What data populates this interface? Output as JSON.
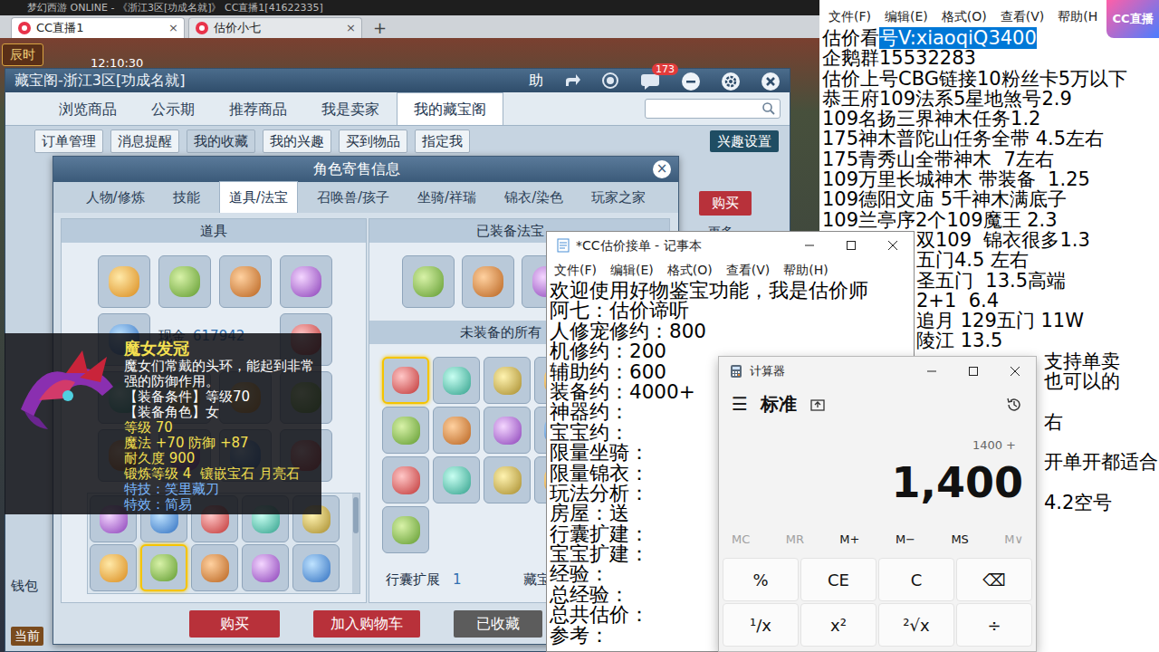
{
  "browser": {
    "caption": "梦幻西游 ONLINE - 《浙江3区[功成名就]》   CC直播1[41622335]",
    "tabs": [
      {
        "label": "CC直播1",
        "close": "×",
        "selected": true
      },
      {
        "label": "估价小七",
        "close": "×",
        "selected": false
      }
    ],
    "new_tab": "+"
  },
  "game": {
    "period": "辰时",
    "clock": "12:10:30"
  },
  "cc_logo": "CC直播",
  "right_notepad": {
    "menu": [
      "文件(F)",
      "编辑(E)",
      "格式(O)",
      "查看(V)",
      "帮助(H"
    ],
    "heading": [
      {
        "text": "估价看",
        "selected": false
      },
      {
        "text": "号V:xiaoqiQ3400",
        "selected": true
      }
    ],
    "lines": [
      "企鹅群15532283",
      "估价上号CBG链接10粉丝卡5万以下",
      "恭王府109法系5星地煞号2.9",
      "109名扬三界神木任务1.2",
      "175神木普陀山任务全带 4.5左右",
      "175青秀山全带神木  7左右",
      "109万里长城神木 带装备  1.25",
      "109德阳文庙 5千神木满底子",
      "109兰亭序2个109魔王 2.3"
    ],
    "mid_lines": [
      "双109  锦衣很多1.3",
      "五门4.5 左右",
      "圣五门  13.5高端",
      "2+1  6.4",
      "追月 129五门 11W",
      "陵江 13.5"
    ],
    "low_lines": [
      "支持单卖",
      "也可以的",
      "右",
      "开单开都适合",
      "4.2空号"
    ]
  },
  "cbg": {
    "title": "藏宝阁-浙江3区[功成名就]",
    "help": "助",
    "badge": "173",
    "nav": [
      {
        "label": "浏览商品",
        "selected": false
      },
      {
        "label": "公示期",
        "selected": false
      },
      {
        "label": "推荐商品",
        "selected": false
      },
      {
        "label": "我是卖家",
        "selected": false
      },
      {
        "label": "我的藏宝阁",
        "selected": true
      }
    ],
    "subnav": [
      {
        "label": "订单管理",
        "selected": false
      },
      {
        "label": "消息提醒",
        "selected": false
      },
      {
        "label": "我的收藏",
        "selected": true
      },
      {
        "label": "我的兴趣",
        "selected": false
      },
      {
        "label": "买到物品",
        "selected": false
      },
      {
        "label": "指定我",
        "selected": false
      }
    ],
    "interest_settings": "兴趣设置",
    "buy": "购买",
    "more": "更多",
    "wallet": "钱包",
    "current": "当前"
  },
  "dialog": {
    "title": "角色寄售信息",
    "close": "×",
    "tabs": [
      {
        "label": "人物/修炼",
        "selected": false
      },
      {
        "label": "技能",
        "selected": false
      },
      {
        "label": "道具/法宝",
        "selected": true
      },
      {
        "label": "召唤兽/孩子",
        "selected": false
      },
      {
        "label": "坐骑/祥瑞",
        "selected": false
      },
      {
        "label": "锦衣/染色",
        "selected": false
      },
      {
        "label": "玩家之家",
        "selected": false
      }
    ],
    "items_header": "道具",
    "cash_label": "现金",
    "cash_value": "617942",
    "items": [
      {
        "selected": false
      },
      {
        "selected": false
      },
      {
        "selected": false
      },
      {
        "selected": false
      },
      {
        "selected": false
      },
      {
        "selected": false
      },
      {
        "selected": false
      },
      {
        "selected": false
      },
      {
        "selected": false
      },
      {
        "selected": false
      },
      {
        "selected": false
      },
      {
        "selected": false
      },
      {
        "selected": false
      },
      {
        "selected": false
      }
    ],
    "lower_items": [
      {
        "selected": false
      },
      {
        "selected": false
      },
      {
        "selected": false
      },
      {
        "selected": false
      },
      {
        "selected": false
      },
      {
        "selected": false
      },
      {
        "selected": true
      },
      {
        "selected": false
      },
      {
        "selected": false
      },
      {
        "selected": false
      }
    ],
    "equipped_header": "已装备法宝",
    "equipped": [
      {
        "selected": false
      },
      {
        "selected": false
      },
      {
        "selected": false
      }
    ],
    "unequipped_header": "未装备的所有",
    "unequipped": [
      {
        "selected": true
      },
      {
        "selected": false
      },
      {
        "selected": false
      },
      {
        "selected": false
      },
      {
        "selected": false
      },
      {
        "selected": false
      },
      {
        "selected": false
      },
      {
        "selected": false
      },
      {
        "selected": false
      },
      {
        "selected": false
      },
      {
        "selected": false
      },
      {
        "selected": false
      },
      {
        "selected": false
      }
    ],
    "bag_label": "行囊扩展",
    "bag_value": "1",
    "vault_label": "藏宝",
    "buttons": [
      {
        "label": "购买",
        "kind": "primary"
      },
      {
        "label": "加入购物车",
        "kind": "primary"
      },
      {
        "label": "已收藏",
        "kind": "muted"
      }
    ]
  },
  "tooltip": {
    "name": "魔女发冠",
    "lines": [
      {
        "text": "魔女们常戴的头环，能起到非常强的防御作用。",
        "kind": "desc"
      },
      {
        "text": "【装备条件】等级70",
        "kind": "normal"
      },
      {
        "text": "【装备角色】女",
        "kind": "normal"
      },
      {
        "text": "等级 70",
        "kind": "attr"
      },
      {
        "text": "魔法 +70 防御 +87",
        "kind": "attr"
      },
      {
        "text": "耐久度 900",
        "kind": "attr"
      },
      {
        "text": "锻炼等级 4  镶嵌宝石 月亮石",
        "kind": "attr"
      },
      {
        "text": "特技：笑里藏刀",
        "kind": "special"
      },
      {
        "text": "特效：简易",
        "kind": "special"
      }
    ]
  },
  "cc_notepad": {
    "title": "*CC估价接单 - 记事本",
    "menu": [
      "文件(F)",
      "编辑(E)",
      "格式(O)",
      "查看(V)",
      "帮助(H)"
    ],
    "lines": [
      "欢迎使用好物鉴宝功能，我是估价师",
      "阿七：估价谛听",
      "人修宠修约：800",
      "机修约：200",
      "辅助约：600",
      "装备约：4000+",
      "神器约：",
      "宝宝约：",
      "限量坐骑：",
      "限量锦衣：",
      "玩法分析：",
      "房屋：送",
      "行囊扩建：",
      "宝宝扩建：",
      "经验：",
      "总经验：",
      "总共估价：",
      "参考："
    ]
  },
  "calculator": {
    "title": "计算器",
    "menu_icon": "☰",
    "mode": "标准",
    "history": "1400 +",
    "display": "1,400",
    "memory": [
      {
        "label": "MC",
        "disabled": true
      },
      {
        "label": "MR",
        "disabled": true
      },
      {
        "label": "M+",
        "disabled": false
      },
      {
        "label": "M−",
        "disabled": false
      },
      {
        "label": "MS",
        "disabled": false
      },
      {
        "label": "M∨",
        "disabled": true
      }
    ],
    "keys": [
      "%",
      "CE",
      "C",
      "⌫",
      "¹/x",
      "x²",
      "²√x",
      "÷"
    ]
  }
}
